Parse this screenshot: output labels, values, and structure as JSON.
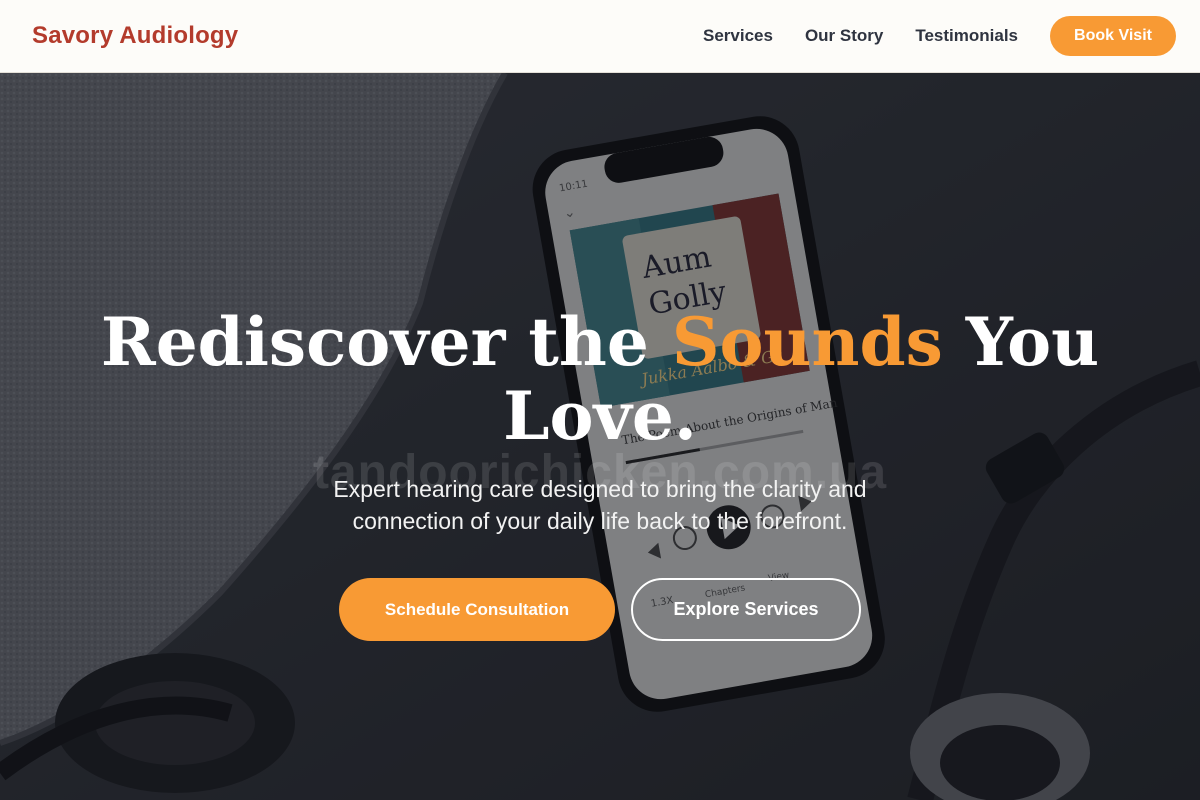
{
  "header": {
    "brand": "Savory Audiology",
    "nav": [
      "Services",
      "Our Story",
      "Testimonials"
    ],
    "cta": "Book Visit"
  },
  "hero": {
    "headline_before": "Rediscover the ",
    "headline_accent": "Sounds",
    "headline_after": " You Love.",
    "watermark": "tandoorichicken.com.ua",
    "subtext": "Expert hearing care designed to bring the clarity and connection of your daily life back to the forefront.",
    "primary_cta": "Schedule Consultation",
    "secondary_cta": "Explore Services",
    "background": {
      "phone_screen": {
        "time": "10:11",
        "album_title_line1": "Aum",
        "album_title_line2": "Golly",
        "album_author": "Jukka Aalbo & Gr",
        "track_title": "The Poem About the Origins of Man",
        "speed": "1.3X",
        "chapters": "Chapters",
        "view": "View"
      }
    }
  },
  "colors": {
    "brand": "#b33b2c",
    "accent": "#f89a34",
    "header_bg": "#fdfcf9",
    "nav_text": "#2f3440"
  },
  "icons": [
    "play-icon",
    "rewind-icon",
    "forward-icon",
    "skip-back-icon",
    "skip-forward-icon",
    "chevron-down-icon",
    "headphones-icon"
  ]
}
